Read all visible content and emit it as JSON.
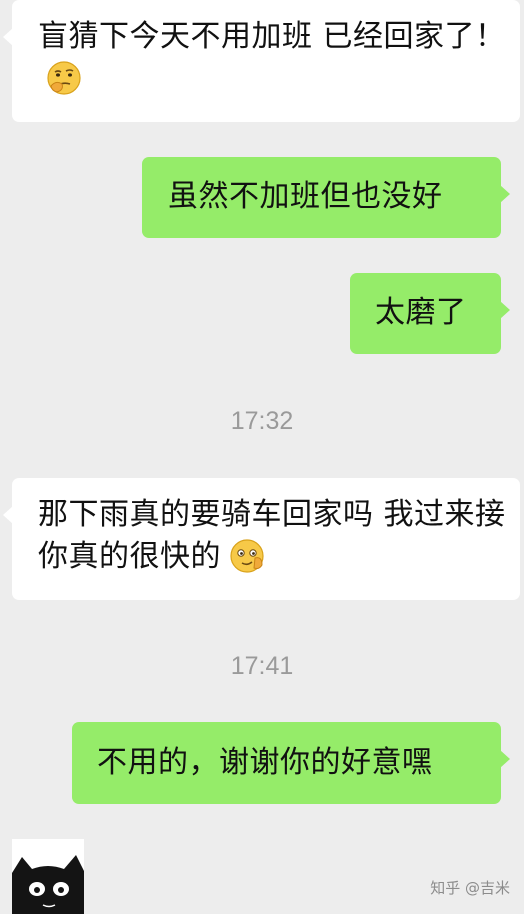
{
  "messages": [
    {
      "side": "left",
      "text": "盲猜下今天不用加班 已经回家了！",
      "emoji": "thinking-face"
    },
    {
      "side": "right",
      "text": "虽然不加班但也没好"
    },
    {
      "side": "right",
      "text": "太磨了"
    },
    {
      "side": "left",
      "text": "那下雨真的要骑车回家吗 我过来接你真的很快的",
      "emoji": "smirk-face"
    },
    {
      "side": "right",
      "text": "不用的，谢谢你的好意嘿"
    }
  ],
  "timestamps": [
    "17:32",
    "17:41"
  ],
  "watermark": "知乎 @吉米",
  "colors": {
    "background": "#ededed",
    "incoming_bubble": "#ffffff",
    "outgoing_bubble": "#95ec69",
    "timestamp": "#9a9a9a"
  }
}
